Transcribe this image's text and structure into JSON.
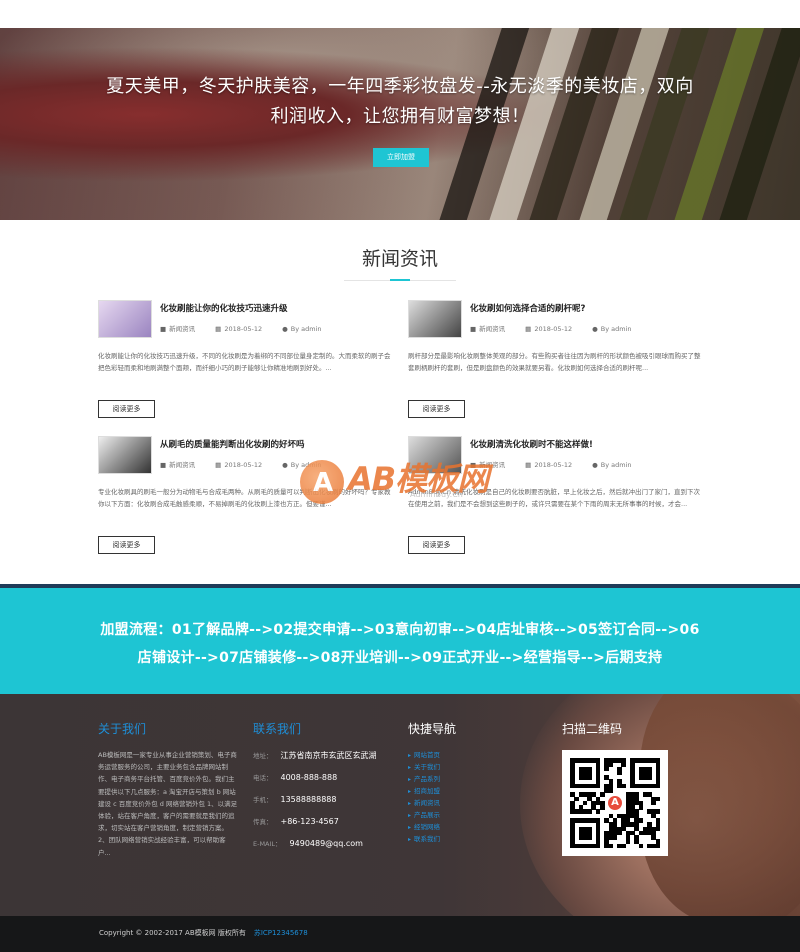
{
  "hero": {
    "title_line1": "夏天美甲，冬天护肤美容，一年四季彩妆盘发--永无淡季的美妆店，双向",
    "title_line2": "利润收入，让您拥有财富梦想！",
    "button_label": "立即加盟"
  },
  "news": {
    "section_title": "新闻资讯",
    "more_label": "阅读更多",
    "items": [
      {
        "title": "化妆刷能让你的化妆技巧迅速升级",
        "category": "新闻资讯",
        "date": "2018-05-12",
        "author": "By admin",
        "desc": "化妆刷能让你的化妆技巧迅速升级，不同的化妆刷是为着绑的不同部位量身定制的。大而柔软的刷子会把色彩轻而柔和地刷满整个面颊，而纤细小巧的刷子能够让你精准地刷到好处。..."
      },
      {
        "title": "化妆刷如何选择合适的刷杆呢?",
        "category": "新闻资讯",
        "date": "2018-05-12",
        "author": "By admin",
        "desc": "刷杆部分是最影响化妆刷整体美观的部分。有些购买者往往因为刷杆的形状颜色被吸引眼球而购买了整套刷柄刷杆的套刷，但是刷盘颜色的效果就要另看。化妆刷如何选择合适的刷杆呢..."
      },
      {
        "title": "从刷毛的质量能判断出化妆刷的好坏吗",
        "category": "新闻资讯",
        "date": "2018-05-12",
        "author": "By admin",
        "desc": "专业化妆刷具的刷毛一般分为动物毛与合成毛两种。从刷毛的质量可以判断出化妆刷的好坏吗？专家教你以下方面：化妆刷合成毛触感柔顺，不易掉刷毛的化妆刷上漆也方正。但要谨..."
      },
      {
        "title": "化妆刷清洗化妆刷时不能这样做!",
        "category": "新闻资讯",
        "date": "2018-05-12",
        "author": "By admin",
        "desc": "AdminBuy.Cn 清洗化妆刷是自己的化妆刷要否肮脏，早上化妆之后，然后就冲出门了家门，直到下次在使用之前，我们是不会想到这些刷子的，或许只需要在某个下雨的周末无所事事的时候，才会..."
      }
    ]
  },
  "watermark": {
    "logo_letter": "A",
    "text": "AB模板网",
    "url": "AdminBuy.Cn"
  },
  "process": {
    "line1": "加盟流程：01了解品牌-->02提交申请-->03意向初审-->04店址审核-->05签订合同-->06",
    "line2": "店铺设计-->07店铺装修-->08开业培训-->09正式开业-->经营指导-->后期支持"
  },
  "footer": {
    "about": {
      "heading": "关于我们",
      "text": "AB模板网是一家专业从事企业营销策划、电子商务运营服务的公司，主要业务包含品牌网站制作、电子商务平台托管、百度竞价外包。我们主要提供以下几点服务：a 淘宝开店与策划 b 网站建设 c 百度竞价外包 d 网络营销外包 1、以满足体验，站在客户角度，客户的需要就是我们的追求，切实站在客户营销角度，制定营销方案。2、团队网络营销实战经验丰富，可以帮助客户..."
    },
    "contact": {
      "heading": "联系我们",
      "rows": [
        {
          "label": "地址：",
          "value": "江苏省南京市玄武区玄武湖"
        },
        {
          "label": "电话：",
          "value": "4008-888-888"
        },
        {
          "label": "手机：",
          "value": "13588888888"
        },
        {
          "label": "传真：",
          "value": "+86-123-4567"
        },
        {
          "label": "E-MAIL：",
          "value": "9490489@qq.com"
        }
      ]
    },
    "nav": {
      "heading": "快捷导航",
      "items": [
        "网站首页",
        "关于我们",
        "产品系列",
        "招商加盟",
        "新闻资讯",
        "产品展示",
        "经销网络",
        "联系我们"
      ]
    },
    "qr": {
      "heading": "扫描二维码"
    }
  },
  "copyright": {
    "text": "Copyright © 2002-2017 AB模板网 版权所有",
    "icp": "苏ICP12345678"
  },
  "colors": {
    "accent": "#1ec5d3",
    "link_blue": "#1e8fd8",
    "footer_bg": "#3c3536",
    "copyright_bg": "#161718"
  }
}
